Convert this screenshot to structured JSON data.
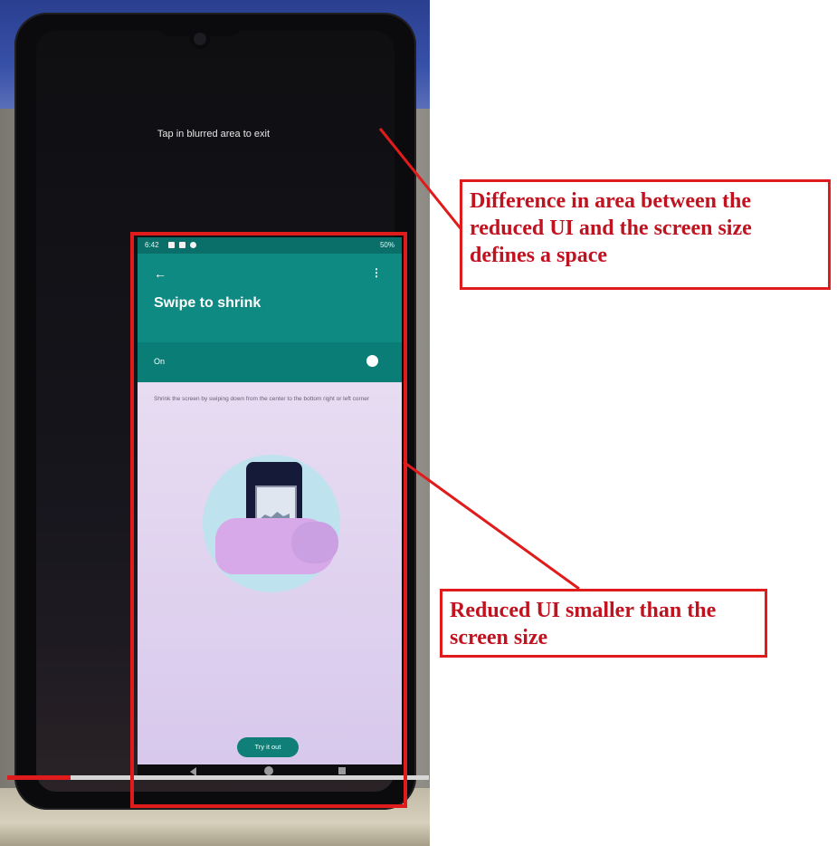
{
  "phone": {
    "hint": "Tap in blurred area to exit",
    "video_progress": 0.15
  },
  "reduced_ui": {
    "status_bar": {
      "time": "6:42",
      "battery": "50%"
    },
    "back_icon": "arrow-left-icon",
    "more_icon": "more-vertical-icon",
    "title": "Swipe to shrink",
    "toggle_label": "On",
    "toggle_state": "on",
    "description": "Shrink the screen by swiping down from the center to the bottom right or left corner",
    "button": "Try it out",
    "nav": {
      "back_icon": "nav-back-icon",
      "home_icon": "nav-home-icon",
      "recent_icon": "nav-recent-icon"
    }
  },
  "annotations": {
    "callout_space": "Difference in area between the reduced UI and the screen size defines a space",
    "callout_reduced": "Reduced UI smaller than the screen size",
    "accent": "#e01b1b"
  }
}
